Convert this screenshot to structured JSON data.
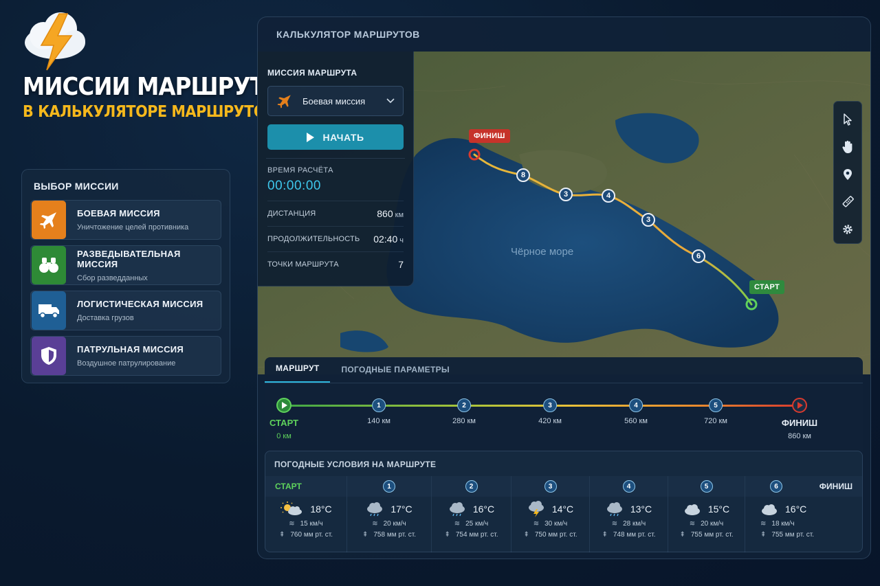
{
  "hero": {
    "title": "МИССИИ МАРШРУТА",
    "subtitle": "В КАЛЬКУЛЯТОРЕ МАРШРУТОВ"
  },
  "mission_panel": {
    "title": "ВЫБОР МИССИИ",
    "items": [
      {
        "label": "БОЕВАЯ МИССИЯ",
        "desc": "Уничтожение целей противника",
        "color": "#e5801c",
        "icon": "jet-icon"
      },
      {
        "label": "РАЗВЕДЫВАТЕЛЬНАЯ МИССИЯ",
        "desc": "Сбор разведданных",
        "color": "#2e8a36",
        "icon": "binoculars-icon"
      },
      {
        "label": "ЛОГИСТИЧЕСКАЯ МИССИЯ",
        "desc": "Доставка грузов",
        "color": "#1f5f95",
        "icon": "truck-icon"
      },
      {
        "label": "ПАТРУЛЬНАЯ МИССИЯ",
        "desc": "Воздушное патрулирование",
        "color": "#5a3f96",
        "icon": "shield-icon"
      }
    ]
  },
  "calc": {
    "header": "КАЛЬКУЛЯТОР МАРШРУТОВ",
    "route_box": {
      "title": "МИССИЯ МАРШРУТА",
      "selected_mission": "Боевая миссия",
      "start_label": "НАЧАТЬ",
      "calc_time_label": "ВРЕМЯ РАСЧЁТА",
      "calc_time": "00:00:00",
      "stats": [
        {
          "label": "ДИСТАНЦИЯ",
          "value": "860",
          "unit": "км"
        },
        {
          "label": "ПРОДОЛЖИТЕЛЬНОСТЬ",
          "value": "02:40",
          "unit": "ч"
        },
        {
          "label": "ТОЧКИ МАРШРУТА",
          "value": "7",
          "unit": ""
        }
      ]
    },
    "map": {
      "finish_label": "ФИНИШ",
      "start_label": "СТАРТ",
      "sea_label": "Чёрное море",
      "waypoints": [
        "8",
        "3",
        "4",
        "3",
        "6"
      ]
    },
    "tabs": [
      "МАРШРУТ",
      "ПОГОДНЫЕ ПАРАМЕТРЫ"
    ],
    "timeline": {
      "start_label": "СТАРТ",
      "start_dist": "0 км",
      "finish_label": "ФИНИШ",
      "finish_dist": "860 км",
      "points": [
        {
          "n": "1",
          "dist": "140 км"
        },
        {
          "n": "2",
          "dist": "280 км"
        },
        {
          "n": "3",
          "dist": "420 км"
        },
        {
          "n": "4",
          "dist": "560 км"
        },
        {
          "n": "5",
          "dist": "720 км"
        }
      ]
    },
    "weather": {
      "title": "ПОГОДНЫЕ УСЛОВИЯ НА МАРШРУТЕ",
      "start_label": "СТАРТ",
      "finish_label": "ФИНИШ",
      "columns": [
        {
          "head": "СТАРТ",
          "icon": "sun-cloud-icon",
          "temp": "18°C",
          "wind": "15 км/ч",
          "pressure": "760 мм рт. ст."
        },
        {
          "head": "1",
          "icon": "rain-cloud-icon",
          "temp": "17°C",
          "wind": "20 км/ч",
          "pressure": "758 мм рт. ст."
        },
        {
          "head": "2",
          "icon": "rain-cloud-icon",
          "temp": "16°C",
          "wind": "25 км/ч",
          "pressure": "754 мм рт. ст."
        },
        {
          "head": "3",
          "icon": "storm-cloud-icon",
          "temp": "14°C",
          "wind": "30 км/ч",
          "pressure": "750 мм рт. ст."
        },
        {
          "head": "4",
          "icon": "rain-cloud-icon",
          "temp": "13°C",
          "wind": "28 км/ч",
          "pressure": "748 мм рт. ст."
        },
        {
          "head": "5",
          "icon": "cloud-icon",
          "temp": "15°C",
          "wind": "20 км/ч",
          "pressure": "755 мм рт. ст."
        },
        {
          "head": "6",
          "icon": "cloud-icon",
          "temp": "16°C",
          "wind": "18 км/ч",
          "pressure": "755 мм рт. ст."
        }
      ]
    }
  }
}
